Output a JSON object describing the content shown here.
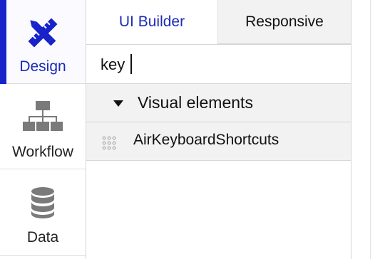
{
  "sidebar": {
    "items": [
      {
        "label": "Design",
        "icon": "design-tools-icon",
        "active": true
      },
      {
        "label": "Workflow",
        "icon": "workflow-icon",
        "active": false
      },
      {
        "label": "Data",
        "icon": "database-icon",
        "active": false
      }
    ]
  },
  "tabs": [
    {
      "label": "UI Builder",
      "active": true
    },
    {
      "label": "Responsive",
      "active": false
    }
  ],
  "search": {
    "value": "key",
    "placeholder": ""
  },
  "group": {
    "label": "Visual elements",
    "expanded": true
  },
  "elements": [
    {
      "label": "AirKeyboardShortcuts",
      "icon": "drag-grip-icon"
    }
  ],
  "colors": {
    "accent": "#1722c9",
    "panel_bg": "#f2f2f2",
    "icon_gray": "#7a7a7a"
  }
}
